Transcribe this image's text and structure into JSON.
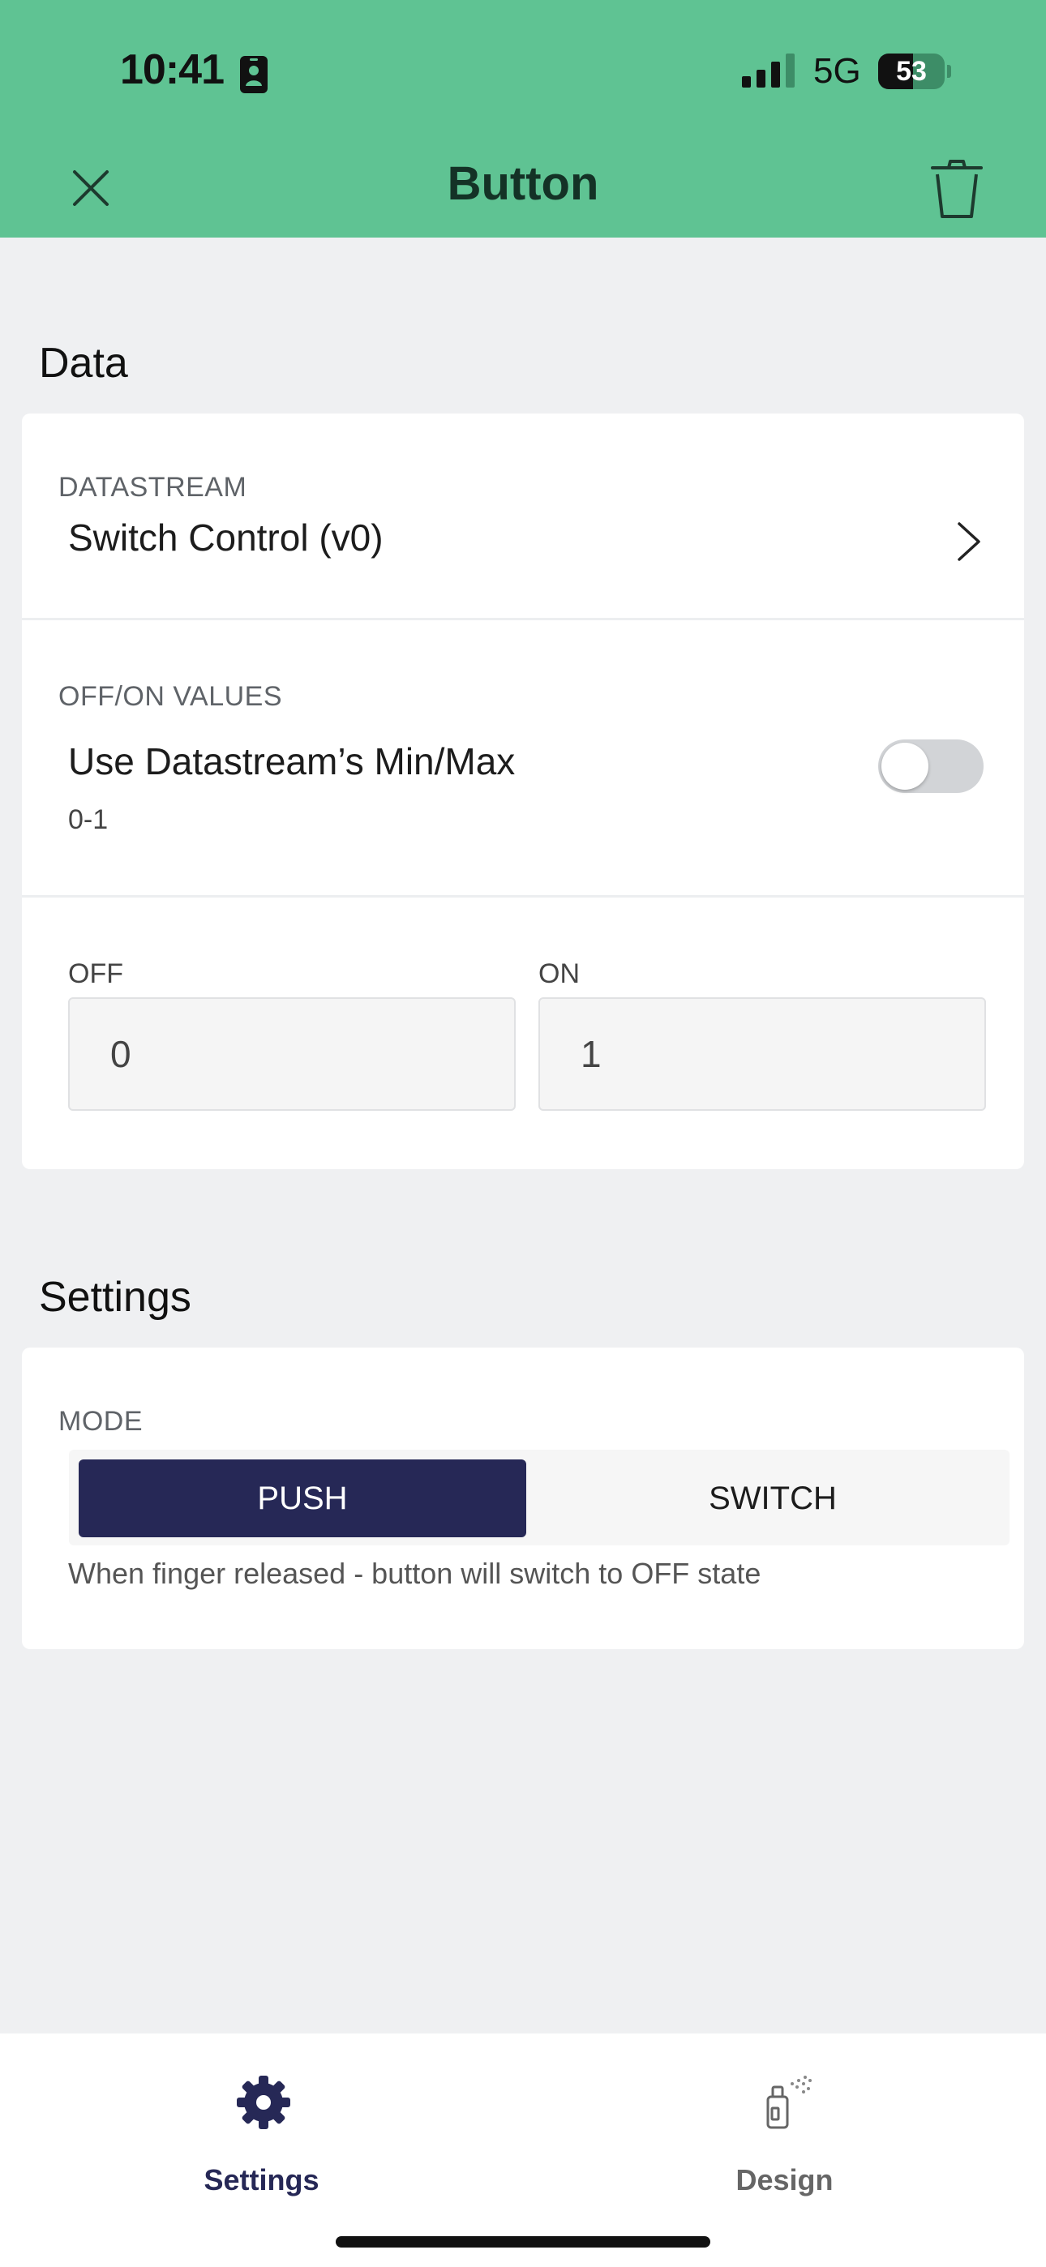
{
  "status_bar": {
    "time": "10:41",
    "network": "5G",
    "battery": "53",
    "battery_level_percent": 53
  },
  "nav": {
    "title": "Button",
    "close_icon": "close-icon",
    "delete_icon": "trash-icon"
  },
  "data_section": {
    "title": "Data",
    "datastream": {
      "label": "DATASTREAM",
      "value": "Switch Control (v0)"
    },
    "off_on_values": {
      "label": "OFF/ON VALUES",
      "toggle_label": "Use Datastream’s Min/Max",
      "range": "0-1",
      "toggle_on": false
    },
    "off": {
      "label": "OFF",
      "value": "0"
    },
    "on": {
      "label": "ON",
      "value": "1"
    }
  },
  "settings_section": {
    "title": "Settings",
    "mode": {
      "label": "MODE",
      "options": [
        "PUSH",
        "SWITCH"
      ],
      "selected": "PUSH",
      "hint": "When finger released - button will switch to OFF state"
    }
  },
  "tabs": [
    {
      "label": "Settings",
      "icon": "gear-icon",
      "active": true
    },
    {
      "label": "Design",
      "icon": "spray-paint-icon",
      "active": false
    }
  ],
  "colors": {
    "header_bg": "#5fc393",
    "accent_dark": "#262856",
    "page_bg": "#eff0f2"
  }
}
